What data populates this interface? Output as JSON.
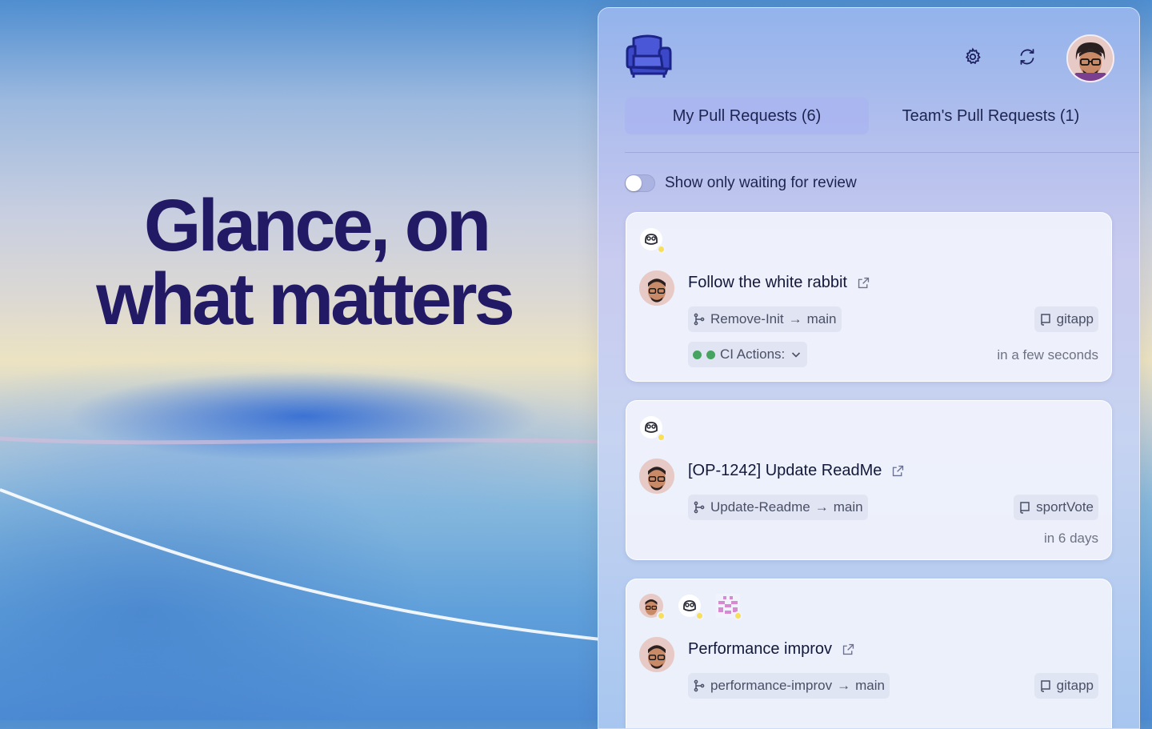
{
  "hero": {
    "line1": "Glance, on",
    "line2": "what matters"
  },
  "header": {
    "logo_icon": "armchair-icon",
    "settings_icon": "gear-icon",
    "refresh_icon": "refresh-icon",
    "avatar": "user-avatar"
  },
  "tabs": [
    {
      "label": "My Pull Requests (6)",
      "active": true
    },
    {
      "label": "Team's Pull Requests (1)",
      "active": false
    }
  ],
  "filter": {
    "label": "Show only waiting for review",
    "enabled": false
  },
  "colors": {
    "hero_text": "#231a66",
    "ci_green": "#46a360",
    "review_pending": "#f7df5a"
  },
  "pull_requests": [
    {
      "title": "Follow the white rabbit",
      "source_branch": "Remove-Init",
      "target_branch": "main",
      "repo": "gitapp",
      "ci_label": "CI Actions:",
      "time": "in a few seconds"
    },
    {
      "title": "[OP-1242] Update ReadMe",
      "source_branch": "Update-Readme",
      "target_branch": "main",
      "repo": "sportVote",
      "time": "in 6 days"
    },
    {
      "title": "Performance improv",
      "source_branch": "performance-improv",
      "target_branch": "main",
      "repo": "gitapp"
    }
  ]
}
